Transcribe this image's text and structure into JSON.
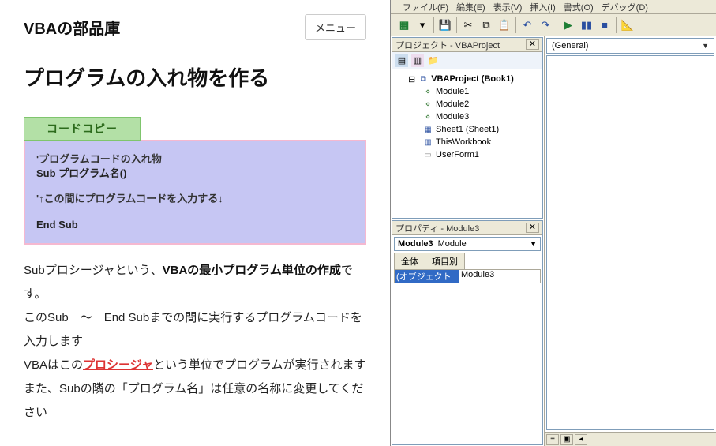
{
  "site": {
    "title": "VBAの部品庫",
    "menu": "メニュー"
  },
  "page": {
    "title": "プログラムの入れ物を作る"
  },
  "code": {
    "copy_label": "コードコピー",
    "l1": "'プログラムコードの入れ物",
    "l2": "Sub プログラム名()",
    "l3": "'↑この間にプログラムコードを入力する↓",
    "l4": "End Sub"
  },
  "body": {
    "t1a": "Subプロシージャという、",
    "t1link": "VBAの最小プログラム単位の作成",
    "t1b": "です。",
    "t2": "このSub　～　End Subまでの間に実行するプログラムコードを入力します",
    "t3a": "VBAはこの",
    "t3link": "プロシージャ",
    "t3b": "という単位でプログラムが実行されます",
    "t4": "また、Subの隣の「プログラム名」は任意の名称に変更してください"
  },
  "vbe": {
    "menubar": {
      "file": "ファイル(F)",
      "edit": "編集(E)",
      "view": "表示(V)",
      "insert": "挿入(I)",
      "format": "書式(O)",
      "debug": "デバッグ(D)"
    },
    "project": {
      "title": "プロジェクト - VBAProject",
      "root": "VBAProject (Book1)",
      "items": [
        "Module1",
        "Module2",
        "Module3",
        "Sheet1 (Sheet1)",
        "ThisWorkbook",
        "UserForm1"
      ]
    },
    "props": {
      "title": "プロパティ - Module3",
      "obj_name": "Module3",
      "obj_type": "Module",
      "tab1": "全体",
      "tab2": "項目別",
      "rows": [
        {
          "name": "(オブジェクト名)",
          "value": "Module3"
        }
      ]
    },
    "codepane": {
      "scope": "(General)"
    }
  }
}
